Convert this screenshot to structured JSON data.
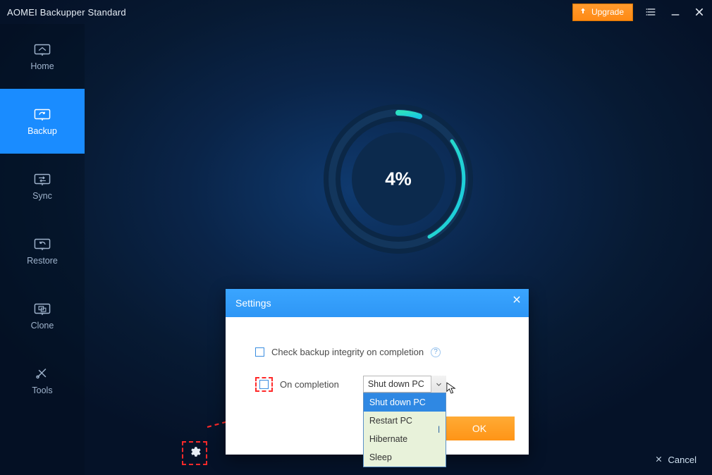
{
  "window": {
    "title": "AOMEI Backupper Standard"
  },
  "titlebar": {
    "upgrade_label": "Upgrade"
  },
  "sidebar": {
    "items": [
      {
        "label": "Home"
      },
      {
        "label": "Backup"
      },
      {
        "label": "Sync"
      },
      {
        "label": "Restore"
      },
      {
        "label": "Clone"
      },
      {
        "label": "Tools"
      }
    ],
    "active_index": 1
  },
  "progress": {
    "percent_label": "4%",
    "percent_value": 4
  },
  "footer": {
    "cancel_label": "Cancel"
  },
  "dialog": {
    "title": "Settings",
    "check_integrity_label": "Check backup integrity on completion",
    "on_completion_label": "On completion",
    "selected_option": "Shut down PC",
    "options": [
      "Shut down PC",
      "Restart PC",
      "Hibernate",
      "Sleep"
    ],
    "ok_label": "OK",
    "cancel_peek": "l"
  }
}
